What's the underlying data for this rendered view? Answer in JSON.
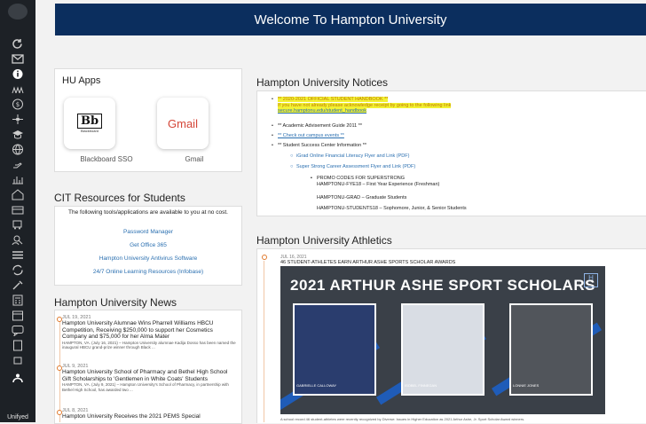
{
  "banner": {
    "title": "Welcome To Hampton University"
  },
  "sidebar": {
    "footer_label": "Unifyed"
  },
  "hu_apps": {
    "title": "HU Apps",
    "apps": [
      {
        "caption": "Blackboard SSO",
        "logo_text": "Bb",
        "logo_sub": "Blackboard"
      },
      {
        "caption": "Gmail",
        "logo_text": "Gmail"
      }
    ]
  },
  "cit": {
    "title": "CIT Resources for Students",
    "intro": "The following tools/applications are available to you at no cost.",
    "links": [
      "Password Manager",
      "Get Office 365",
      "Hampton University Antivirus Software",
      "24/7 Online Learning Resources (Infobase)"
    ]
  },
  "news": {
    "title": "Hampton University News",
    "items": [
      {
        "date": "JUL 19, 2021",
        "title": "Hampton University Alumnae Wins Pharrell Williams HBCU Competition, Receiving $250,000 to support her Cosmetics Company and $75,000 for her Alma Mater",
        "body": "HAMPTON, VA. (July 16, 2021) – Hampton University alumnae Kadija Dosso has been named the inaugural HBCU grand-prize winner through Black ..."
      },
      {
        "date": "JUL 9, 2021",
        "title": "Hampton University School of Pharmacy and Bethel High School Gift Scholarships to 'Gentlemen in White Coats' Students",
        "body": "HAMPTON, VA. (July 9, 2021) – Hampton University's School of Pharmacy, in partnership with Bethel High School, has awarded two ..."
      },
      {
        "date": "JUL 8, 2021",
        "title": "Hampton University Receives the 2021 PEMS Special",
        "body": ""
      }
    ]
  },
  "notices": {
    "title": "Hampton University Notices",
    "handbook_title": "** 2020-2021 OFFICIAL STUDENT HANDBOOK **",
    "handbook_text": "If you have not already please acknowledge receipt by going to the following link",
    "handbook_link": "secure.hamptonu.edu/student_handbook",
    "advisement": "** Academic Advisement Guide 2011 **",
    "events": "** Check out campus events **",
    "success_center": "** Student Success Center Information **",
    "sub_links": [
      "iGrad Online Financial Literacy Flyer and Link (PDF)",
      "Super Strong Career Assessment Flyer and Link (PDF)"
    ],
    "promo_heading": "PROMO CODES FOR SUPERSTRONG",
    "promo_codes": [
      "HAMPTONU-FYE18 – First Year Experience (Freshman)",
      "HAMPTONU-GRAD – Graduate Students",
      "HAMPTONU-STUDENTS18 – Sophomore, Junior, & Senior Students"
    ]
  },
  "athletics": {
    "title": "Hampton University Athletics",
    "date": "JUL 16, 2021",
    "headline": "46 STUDENT-ATHLETES EARN ARTHUR ASHE SPORTS SCHOLAR AWARDS",
    "image_title": "2021 ARTHUR ASHE SPORT SCHOLARS",
    "athletes": [
      "GABRIELLE CALLOWAY",
      "ISOBEL FINNEGAN",
      "LONNIE JONES"
    ],
    "caption": "A school record 46 student-athletes were recently recognized by Diverse: Issues in Higher Education as 2021 Arthur Ashe, Jr. Sport Scholar Award winners."
  },
  "colors": {
    "banner": "#0b2e5e",
    "sidebar": "#1d2126",
    "link": "#2a6fb0",
    "highlight": "#f2f233",
    "accent": "#e07a2d"
  }
}
